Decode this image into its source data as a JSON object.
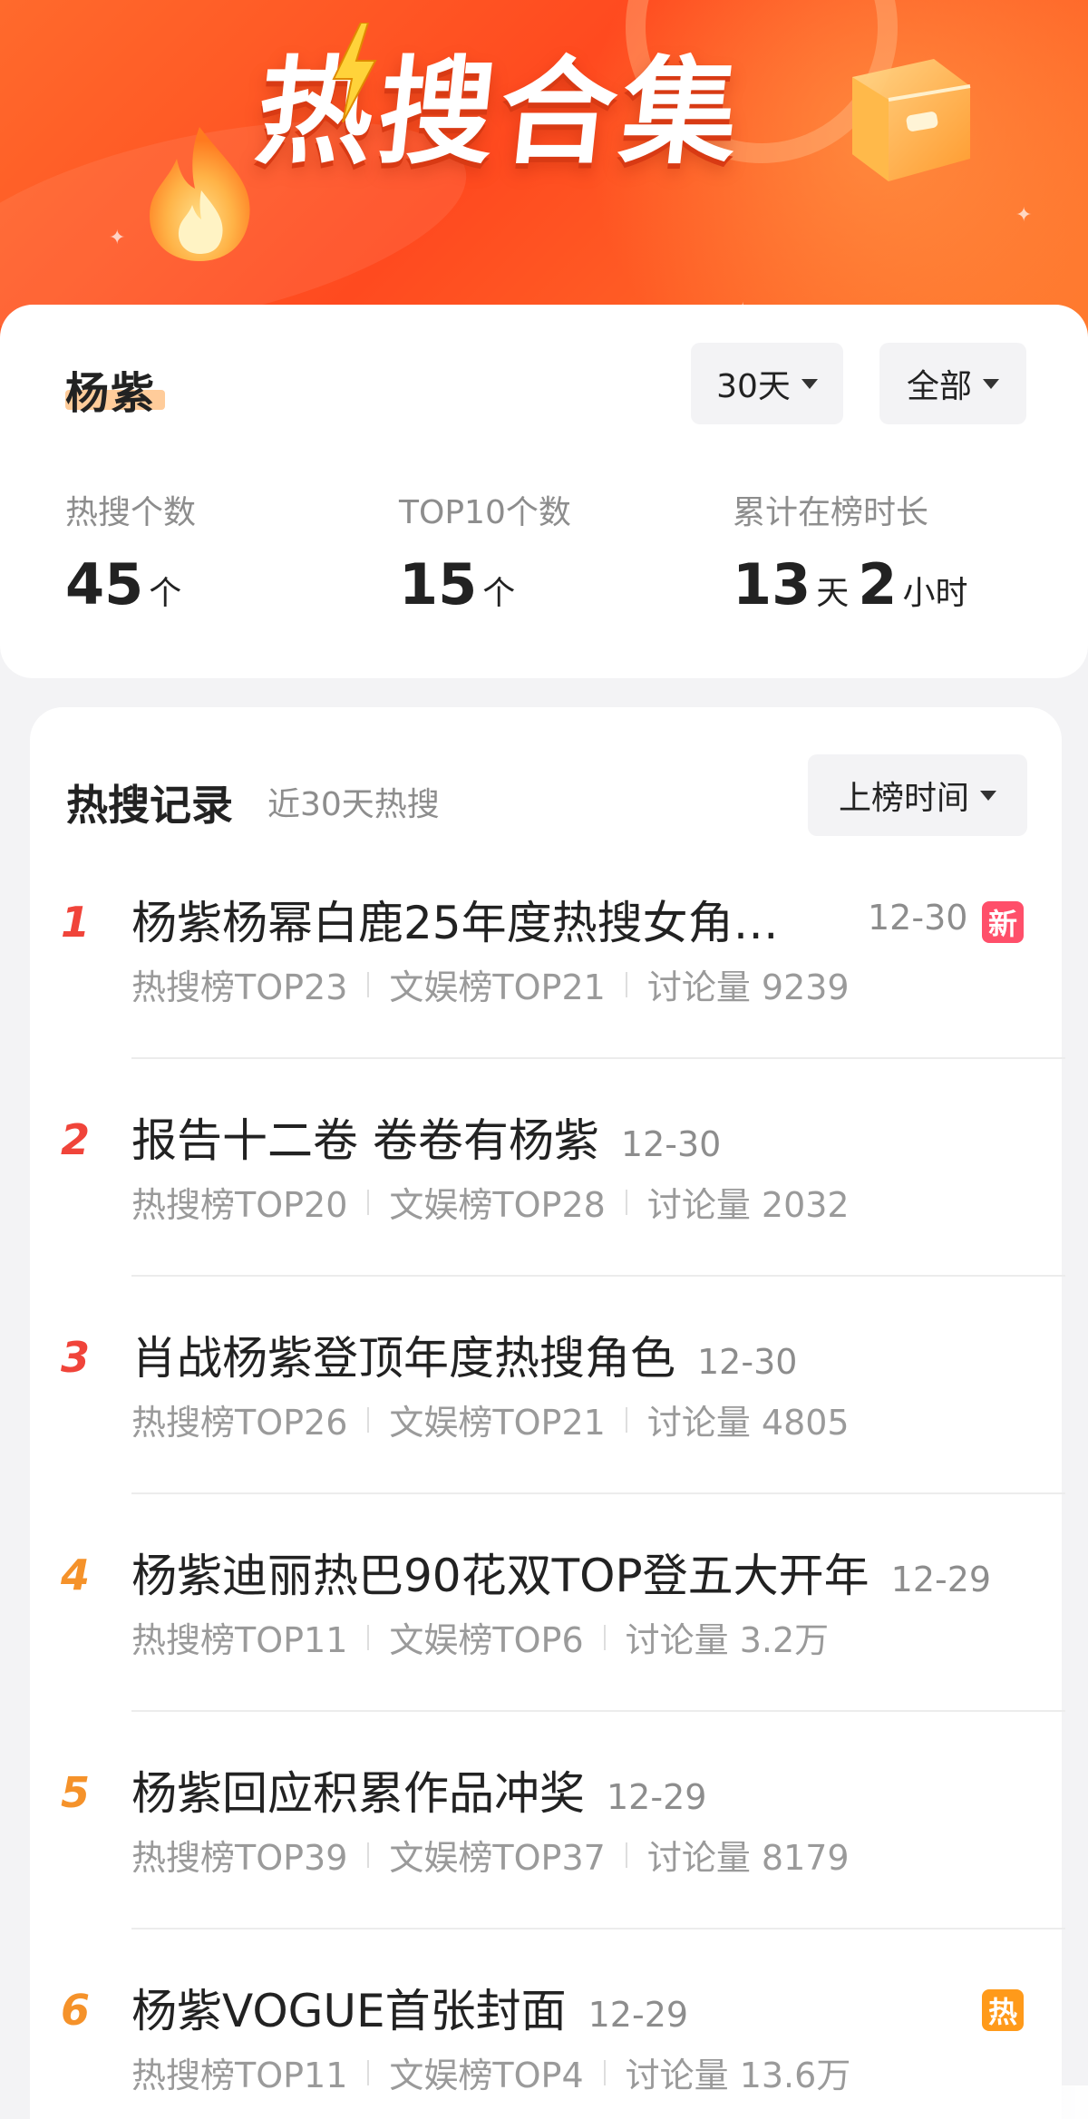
{
  "banner": {
    "title": "热搜合集"
  },
  "summary": {
    "name": "杨紫",
    "filters": {
      "period": "30天",
      "scope": "全部"
    },
    "stats": {
      "count": {
        "label": "热搜个数",
        "value": "45",
        "unit": "个"
      },
      "top10": {
        "label": "TOP10个数",
        "value": "15",
        "unit": "个"
      },
      "duration": {
        "label": "累计在榜时长",
        "days": "13",
        "days_unit": "天",
        "hours": "2",
        "hours_unit": "小时"
      }
    }
  },
  "records": {
    "title": "热搜记录",
    "subtitle": "近30天热搜",
    "sort_label": "上榜时间",
    "colors": {
      "top3": "#f0443a",
      "rest": "#f5922a"
    },
    "items": [
      {
        "rank": "1",
        "title": "杨紫杨幂白鹿25年度热搜女角…",
        "date": "12-30",
        "badge": "新",
        "hot": "热搜榜TOP23",
        "ent": "文娱榜TOP21",
        "discuss": "讨论量 9239"
      },
      {
        "rank": "2",
        "title": "报告十二卷 卷卷有杨紫",
        "date": "12-30",
        "badge": "",
        "hot": "热搜榜TOP20",
        "ent": "文娱榜TOP28",
        "discuss": "讨论量 2032"
      },
      {
        "rank": "3",
        "title": "肖战杨紫登顶年度热搜角色",
        "date": "12-30",
        "badge": "",
        "hot": "热搜榜TOP26",
        "ent": "文娱榜TOP21",
        "discuss": "讨论量 4805"
      },
      {
        "rank": "4",
        "title": "杨紫迪丽热巴90花双TOP登五大开年",
        "date": "12-29",
        "badge": "",
        "hot": "热搜榜TOP11",
        "ent": "文娱榜TOP6",
        "discuss": "讨论量 3.2万"
      },
      {
        "rank": "5",
        "title": "杨紫回应积累作品冲奖",
        "date": "12-29",
        "badge": "",
        "hot": "热搜榜TOP39",
        "ent": "文娱榜TOP37",
        "discuss": "讨论量 8179"
      },
      {
        "rank": "6",
        "title": "杨紫VOGUE首张封面",
        "date": "12-29",
        "badge": "热",
        "hot": "热搜榜TOP11",
        "ent": "文娱榜TOP4",
        "discuss": "讨论量 13.6万"
      }
    ]
  }
}
